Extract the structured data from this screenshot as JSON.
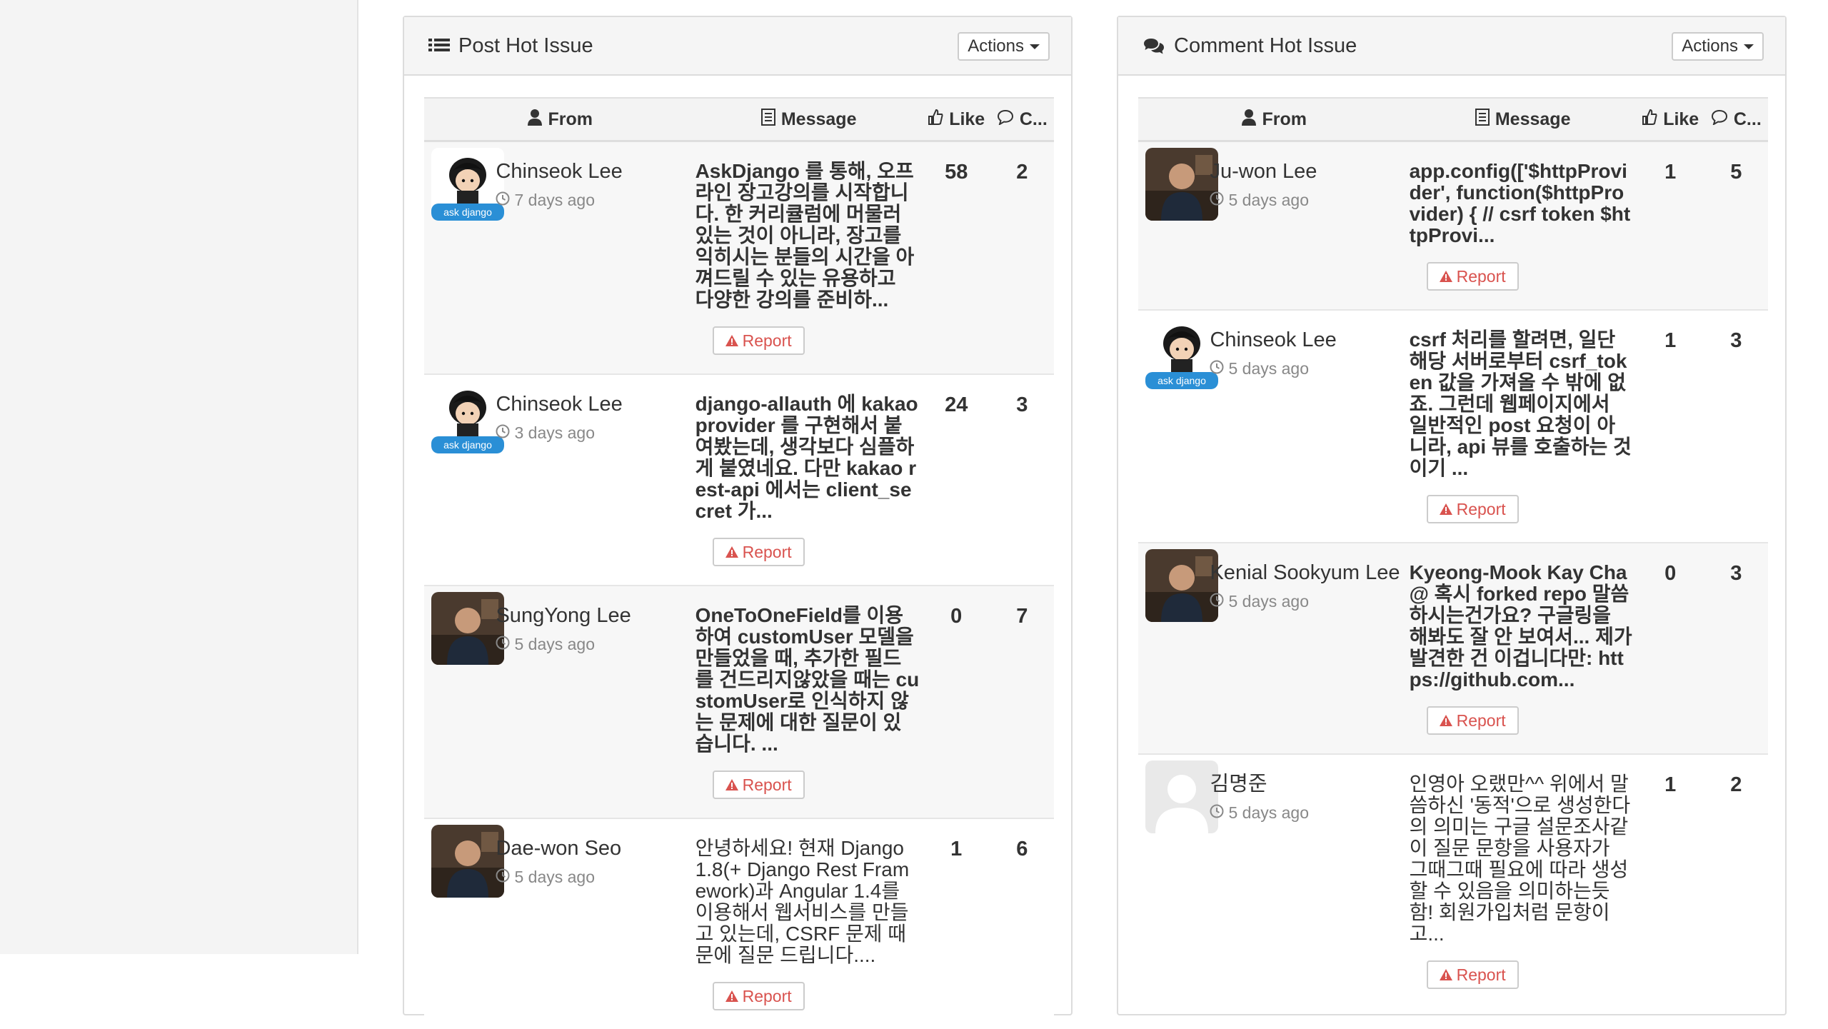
{
  "left_panel": {
    "title": "Post Hot Issue",
    "actions_label": "Actions",
    "columns": {
      "from": "From",
      "message": "Message",
      "like": "Like",
      "comments": "C..."
    },
    "rows": [
      {
        "name": "Chinseok Lee",
        "time": "7 days ago",
        "message": "AskDjango 를 통해, 오프라인 장고강의를 시작합니다. 한 커리큘럼에 머물러있는 것이 아니라, 장고를 익히시는 분들의 시간을 아껴드릴 수 있는 유용하고 다양한 강의를 준비하...",
        "like": "58",
        "comments": "2",
        "report": "Report",
        "avatar": "askdjango"
      },
      {
        "name": "Chinseok Lee",
        "time": "3 days ago",
        "message": "django-allauth 에 kakao provider 를 구현해서 붙여봤는데, 생각보다 심플하게 붙였네요. 다만 kakao rest-api 에서는 client_secret 가...",
        "like": "24",
        "comments": "3",
        "report": "Report",
        "avatar": "askdjango"
      },
      {
        "name": "SungYong Lee",
        "time": "5 days ago",
        "message": "OneToOneField를 이용하여 customUser 모델을 만들었을 때, 추가한 필드를 건드리지않았을 때는 customUser로 인식하지 않는 문제에 대한 질문이 있습니다. ...",
        "like": "0",
        "comments": "7",
        "report": "Report",
        "avatar": "photo"
      },
      {
        "name": "Dae-won Seo",
        "time": "5 days ago",
        "message": "안녕하세요! 현재 Django 1.8(+ Django Rest Framework)과 Angular 1.4를 이용해서 웹서비스를 만들고 있는데, CSRF 문제 때문에 질문 드립니다....",
        "like": "1",
        "comments": "6",
        "report": "Report",
        "avatar": "photo"
      }
    ]
  },
  "right_panel": {
    "title": "Comment Hot Issue",
    "actions_label": "Actions",
    "columns": {
      "from": "From",
      "message": "Message",
      "like": "Like",
      "comments": "C..."
    },
    "rows": [
      {
        "name": "Ju-won Lee",
        "time": "5 days ago",
        "message": "app.config(['$httpProvider', function($httpProvider) { // csrf token $httpProvi...",
        "like": "1",
        "comments": "5",
        "report": "Report",
        "avatar": "photo"
      },
      {
        "name": "Chinseok Lee",
        "time": "5 days ago",
        "message": "csrf 처리를 할려면, 일단 해당 서버로부터 csrf_token 값을 가져올 수 밖에 없죠. 그런데 웹페이지에서 일반적인 post 요청이 아니라, api 뷰를 호출하는 것이기 ...",
        "like": "1",
        "comments": "3",
        "report": "Report",
        "avatar": "askdjango"
      },
      {
        "name": "Kenial Sookyum Lee",
        "time": "5 days ago",
        "message": "Kyeong-Mook Kay Cha @ 혹시 forked repo 말씀하시는건가요? 구글링을 해봐도 잘 안 보여서... 제가 발견한 건 이겁니다만: https://github.com...",
        "like": "0",
        "comments": "3",
        "report": "Report",
        "avatar": "photo"
      },
      {
        "name": "김명준",
        "time": "5 days ago",
        "message": "인영아 오랬만^^ 위에서 말씀하신 '동적'으로 생성한다의 의미는 구글 설문조사같이 질문 문항을 사용자가 그때그때 필요에 따라 생성할 수 있음을 의미하는듯함! 회원가입처럼 문항이 고...",
        "like": "1",
        "comments": "2",
        "report": "Report",
        "avatar": "placeholder"
      }
    ]
  },
  "avatar_label": "ask django",
  "colors": {
    "report": "#d9534f",
    "askdjango_blue": "#2a8fd6"
  },
  "icons": {
    "list": "list-icon",
    "comments": "comments-icon",
    "user": "user-icon",
    "message": "file-text-icon",
    "like": "thumbs-up-icon",
    "comment": "comment-icon",
    "time": "clock-icon",
    "warning": "warning-icon",
    "caret": "caret-down-icon"
  }
}
